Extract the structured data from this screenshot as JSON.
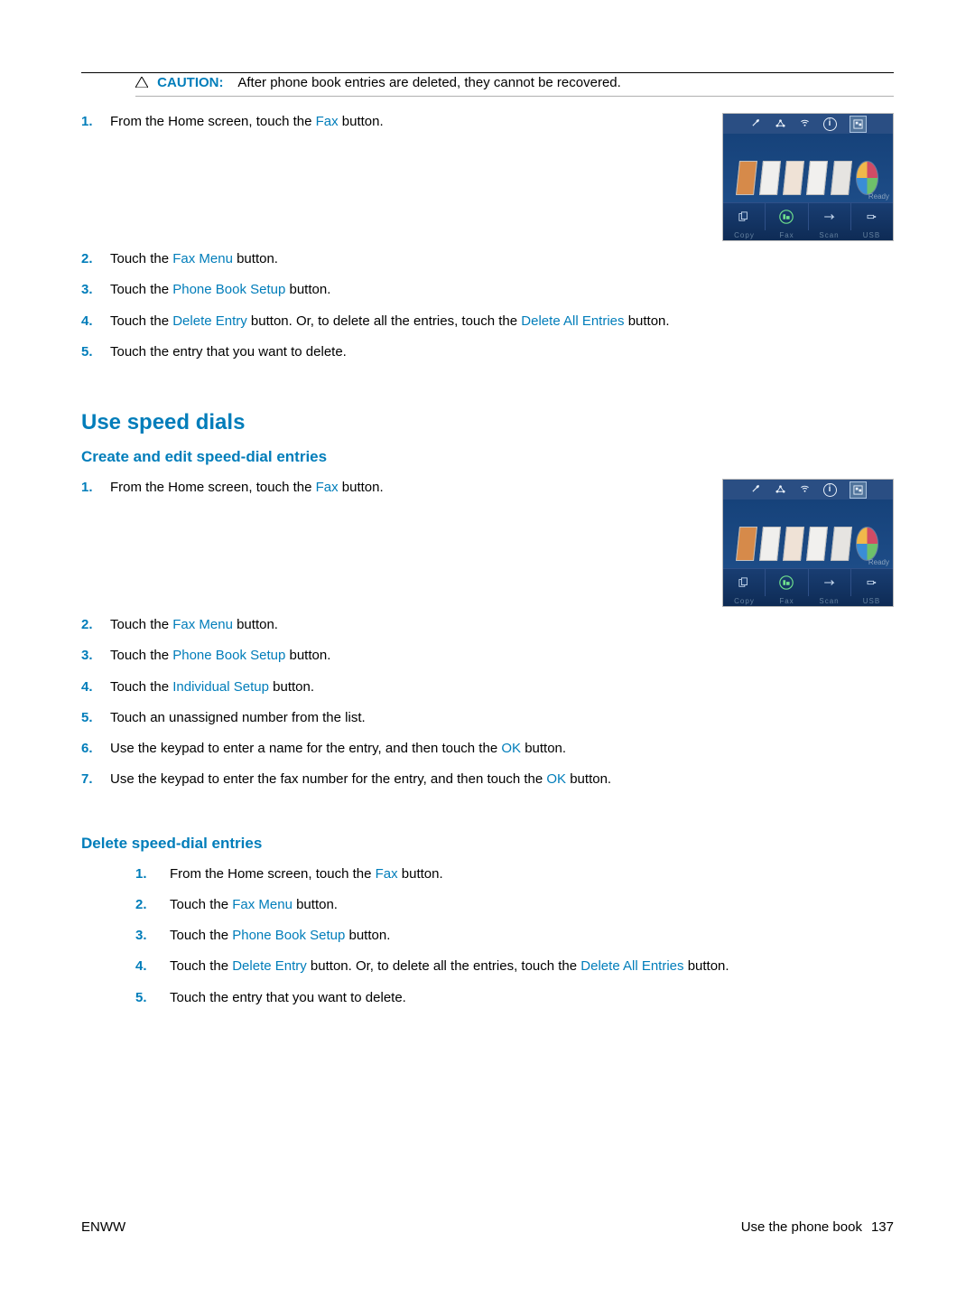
{
  "caution": {
    "label": "CAUTION:",
    "text": "After phone book entries are deleted, they cannot be recovered."
  },
  "blockA": {
    "step1_a": "From the Home screen, touch the ",
    "step1_link": "Fax",
    "step1_b": " button."
  },
  "blockB": {
    "s2_a": "Touch the ",
    "s2_link": "Fax Menu",
    "s2_b": " button.",
    "s3_a": "Touch the ",
    "s3_link": "Phone Book Setup",
    "s3_b": " button.",
    "s4_a": "Touch the ",
    "s4_link1": "Delete Entry",
    "s4_b": " button. Or, to delete all the entries, touch the ",
    "s4_link2": "Delete All Entries",
    "s4_c": " button.",
    "s5": "Touch the entry that you want to delete."
  },
  "section_speed": "Use speed dials",
  "sub_create": "Create and edit speed-dial entries",
  "blockC": {
    "step1_a": "From the Home screen, touch the ",
    "step1_link": "Fax",
    "step1_b": " button."
  },
  "blockD": {
    "s2_a": "Touch the ",
    "s2_link": "Fax Menu",
    "s2_b": " button.",
    "s3_a": "Touch the ",
    "s3_link": "Phone Book Setup",
    "s3_b": " button.",
    "s4_a": "Touch the ",
    "s4_link": "Individual Setup",
    "s4_b": " button.",
    "s5": "Touch an unassigned number from the list.",
    "s6_a": "Use the keypad to enter a name for the entry, and then touch the ",
    "s6_link": "OK",
    "s6_b": " button.",
    "s7_a": "Use the keypad to enter the fax number for the entry, and then touch the ",
    "s7_link": "OK",
    "s7_b": " button."
  },
  "sub_delete": "Delete speed-dial entries",
  "blockE": {
    "s1_a": "From the Home screen, touch the ",
    "s1_link": "Fax",
    "s1_b": " button.",
    "s2_a": "Touch the ",
    "s2_link": "Fax Menu",
    "s2_b": " button.",
    "s3_a": "Touch the ",
    "s3_link": "Phone Book Setup",
    "s3_b": " button.",
    "s4_a": "Touch the ",
    "s4_link1": "Delete Entry",
    "s4_b": " button. Or, to delete all the entries, touch the ",
    "s4_link2": "Delete All Entries",
    "s4_c": " button.",
    "s5": "Touch the entry that you want to delete."
  },
  "footer": {
    "left": "ENWW",
    "right_text": "Use the phone book",
    "page": "137"
  },
  "screenshot": {
    "top_icons": [
      "wrench-icon",
      "network-icon",
      "wifi-icon",
      "info-icon",
      "collage-icon"
    ],
    "bottom_labels": [
      "Copy",
      "Fax",
      "Scan",
      "USB"
    ],
    "ready": "Ready"
  }
}
